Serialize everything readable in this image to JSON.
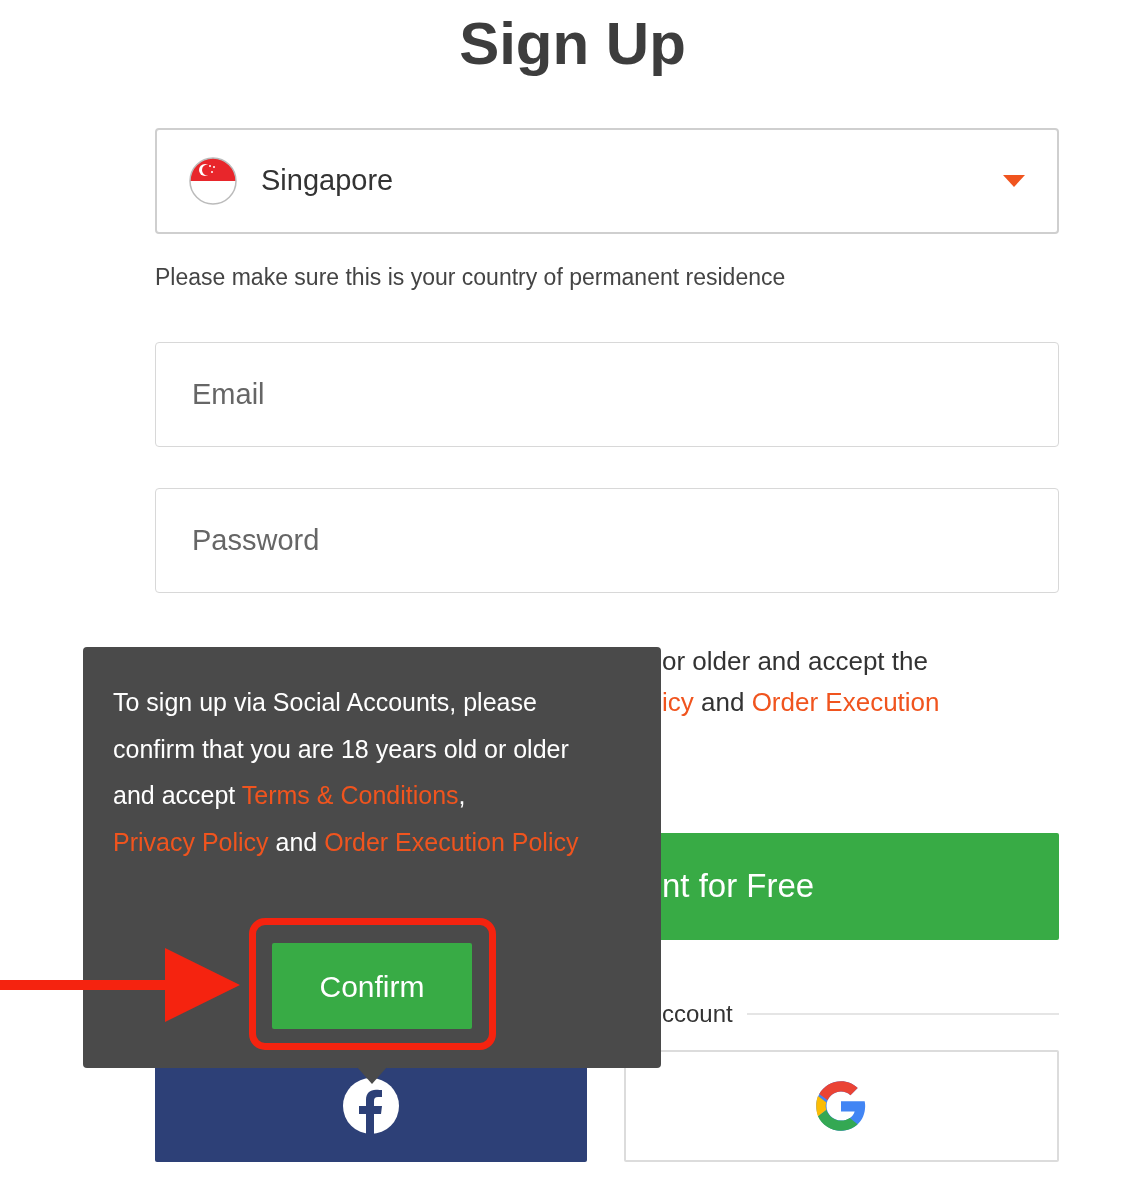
{
  "title": "Sign Up",
  "country": {
    "value": "Singapore"
  },
  "country_hint": "Please make sure this is your country of permanent residence",
  "fields": [
    {
      "placeholder": "Email"
    },
    {
      "placeholder": "Password"
    }
  ],
  "terms_lines": [
    [
      {
        "kind": "plain",
        "text": "or older and accept the"
      }
    ],
    [
      {
        "kind": "link",
        "text": "icy"
      },
      {
        "kind": "plain",
        "text": "and"
      },
      {
        "kind": "link",
        "text": "Order Execution"
      }
    ]
  ],
  "submit_button": "nt for Free",
  "divider_label": "ccount",
  "social_buttons": [
    {
      "kind": "facebook"
    },
    {
      "kind": "google"
    }
  ],
  "tooltip": {
    "segments": [
      {
        "kind": "plain",
        "text": "To sign up via Social Accounts, please confirm that you are 18 years old or older and accept "
      },
      {
        "kind": "link",
        "text": "Terms & Conditions"
      },
      {
        "kind": "plain",
        "text": ", "
      },
      {
        "kind": "link",
        "text": "Privacy Policy"
      },
      {
        "kind": "plain",
        "text": " and "
      },
      {
        "kind": "link",
        "text": "Order Execution Policy"
      }
    ],
    "button": "Confirm",
    "highlighted": true
  }
}
